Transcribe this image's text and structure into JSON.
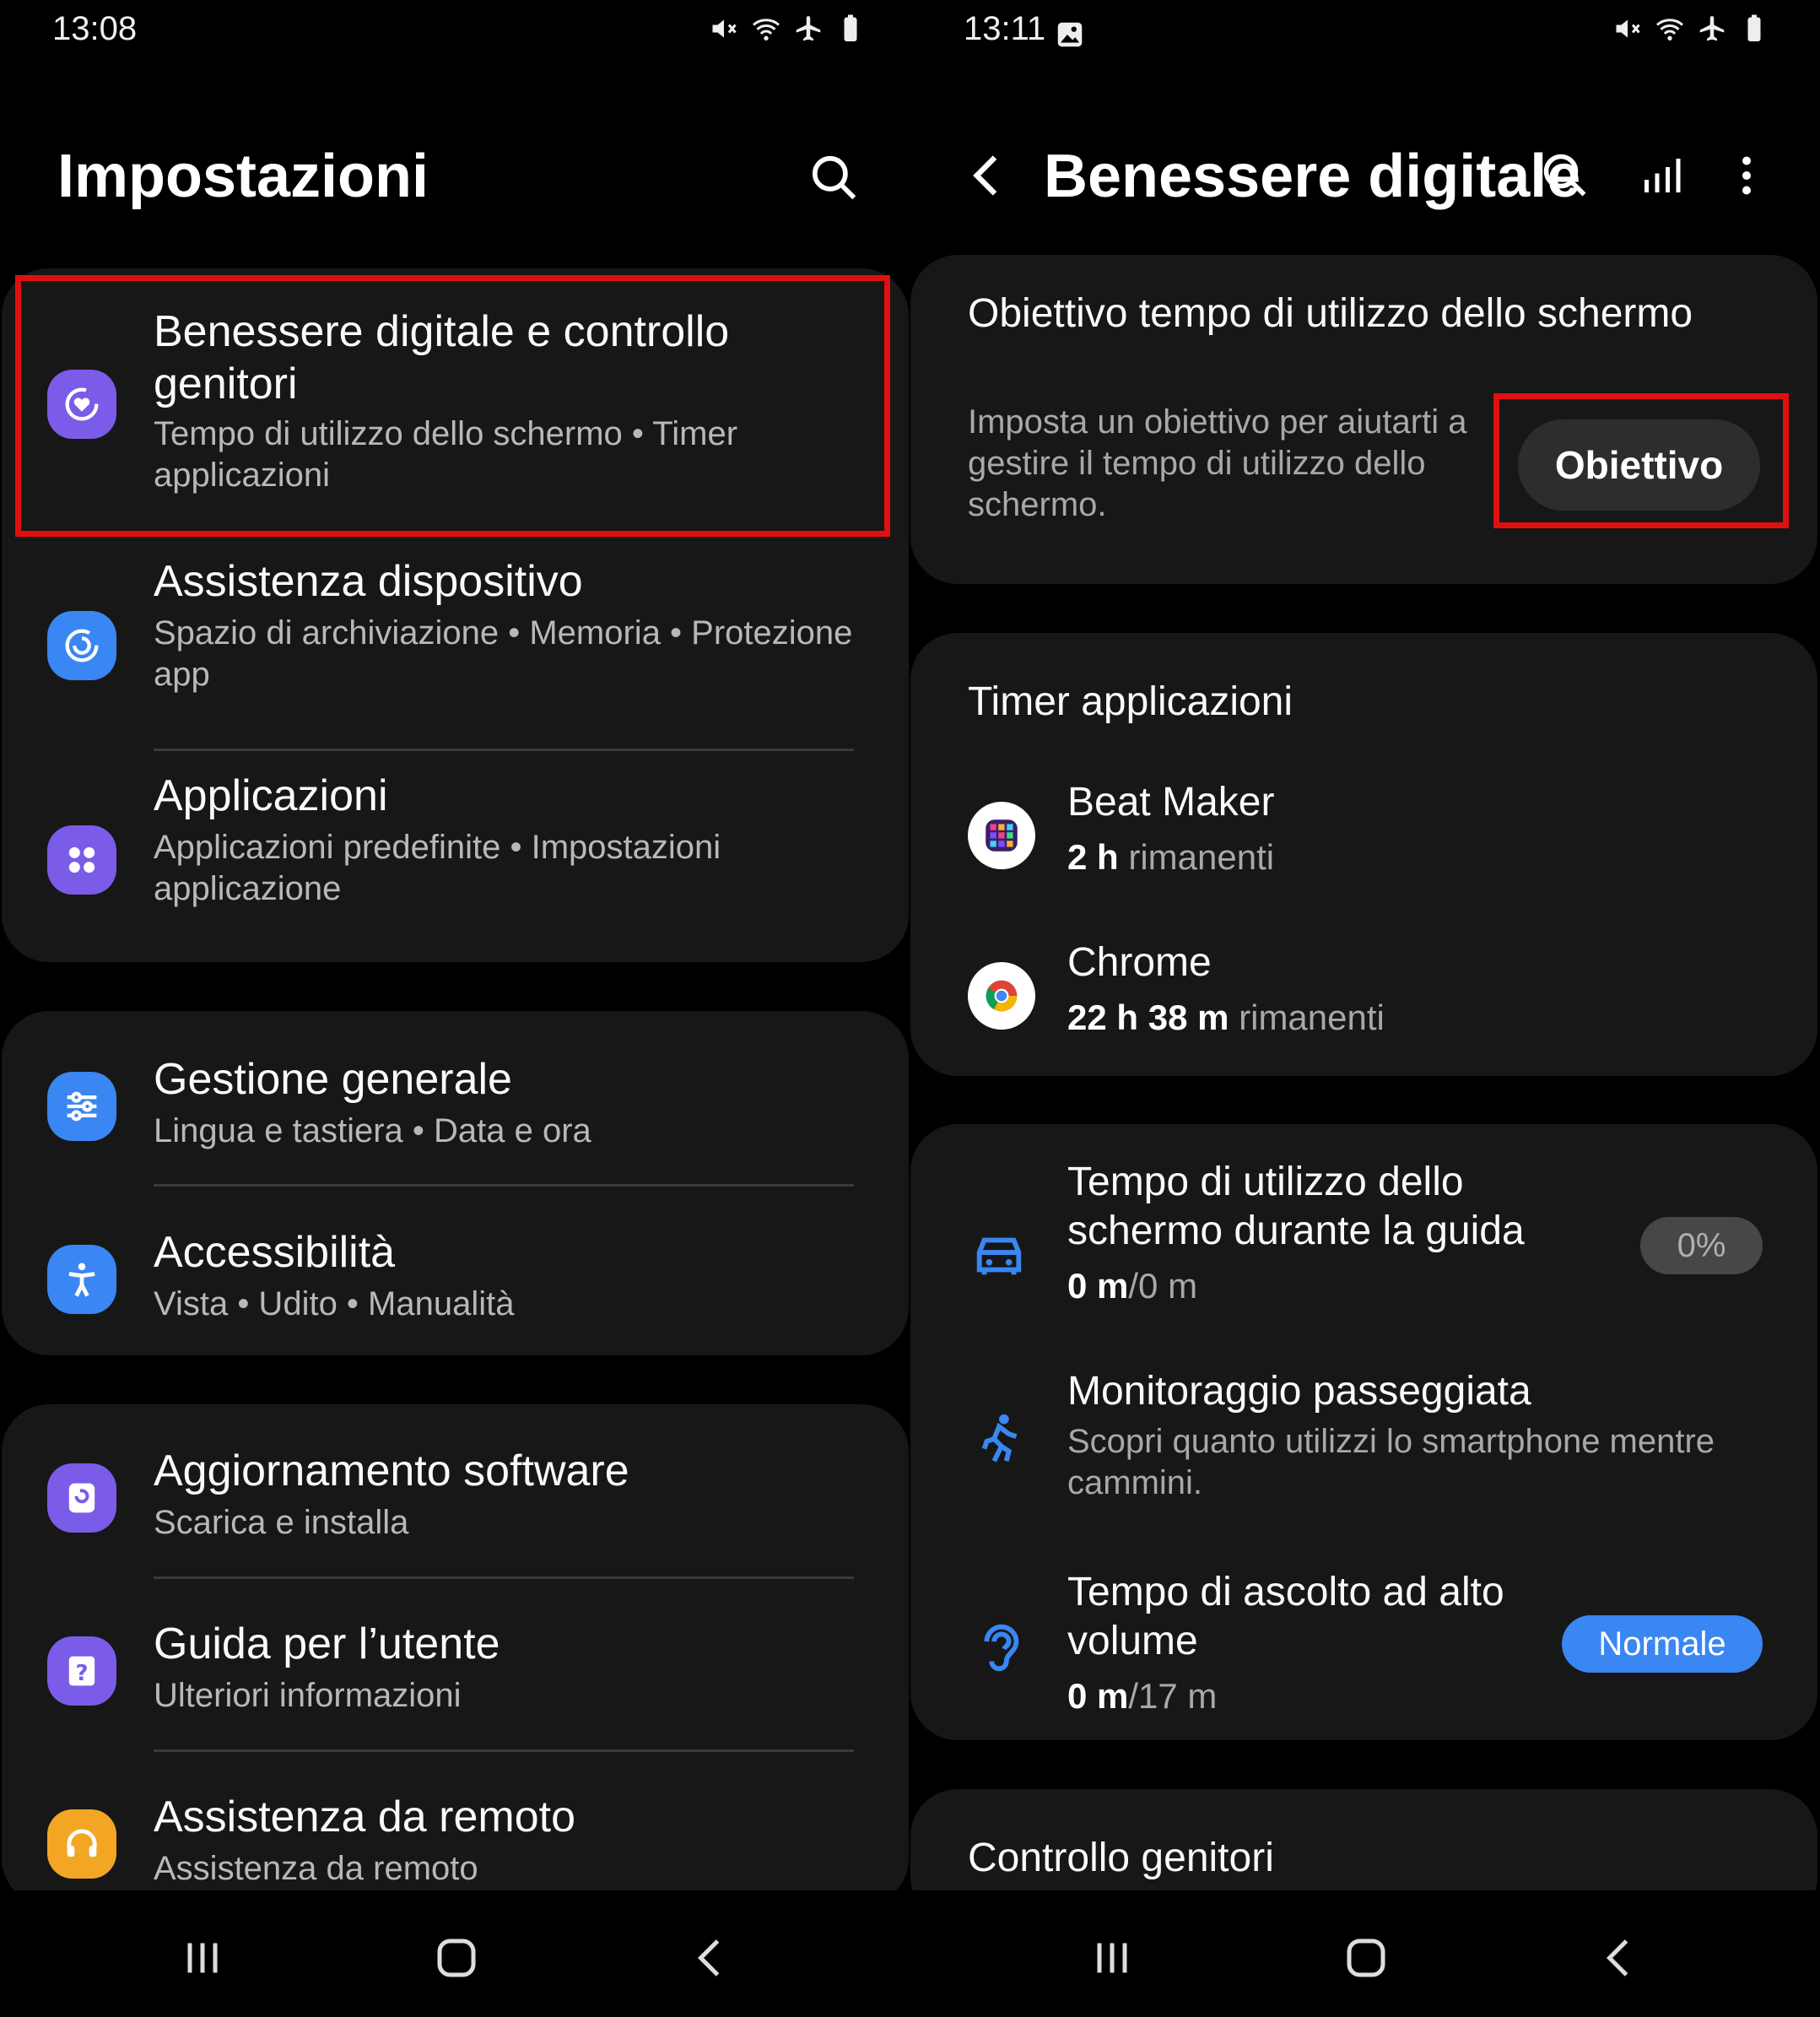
{
  "left": {
    "status_time": "13:08",
    "title": "Impostazioni",
    "groups": [
      [
        {
          "title": "Benessere digitale e controllo genitori",
          "subtitle": "Tempo di utilizzo dello schermo  •  Timer applicazioni",
          "icon": "heart-circle-icon",
          "color": "#7a5ce8"
        },
        {
          "title": "Assistenza dispositivo",
          "subtitle": "Spazio di archiviazione  •  Memoria  •  Protezione app",
          "icon": "device-care-icon",
          "color": "#3a86f2"
        },
        {
          "title": "Applicazioni",
          "subtitle": "Applicazioni predefinite  •  Impostazioni applicazione",
          "icon": "apps-grid-icon",
          "color": "#7a5ce8"
        }
      ],
      [
        {
          "title": "Gestione generale",
          "subtitle": "Lingua e tastiera  •  Data e ora",
          "icon": "sliders-icon",
          "color": "#3a86f2"
        },
        {
          "title": "Accessibilità",
          "subtitle": "Vista  •  Udito  •  Manualità",
          "icon": "accessibility-icon",
          "color": "#3a86f2"
        }
      ],
      [
        {
          "title": "Aggiornamento software",
          "subtitle": "Scarica e installa",
          "icon": "software-update-icon",
          "color": "#7a5ce8"
        },
        {
          "title": "Guida per l’utente",
          "subtitle": "Ulteriori informazioni",
          "icon": "user-guide-icon",
          "color": "#7a5ce8"
        },
        {
          "title": "Assistenza da remoto",
          "subtitle": "Assistenza da remoto",
          "icon": "headset-icon",
          "color": "#f3a623"
        }
      ]
    ]
  },
  "right": {
    "status_time": "13:11",
    "title": "Benessere digitale",
    "goal": {
      "heading": "Obiettivo tempo di utilizzo dello schermo",
      "description": "Imposta un obiettivo per aiutarti a gestire il tempo di utilizzo dello schermo.",
      "button": "Obiettivo"
    },
    "timers": {
      "heading": "Timer applicazioni",
      "apps": [
        {
          "name": "Beat Maker",
          "value": "2 h",
          "suffix": " rimanenti",
          "icon": "beat-maker-icon"
        },
        {
          "name": "Chrome",
          "value": "22 h 38 m",
          "suffix": " rimanenti",
          "icon": "chrome-icon"
        }
      ]
    },
    "driving": {
      "title": "Tempo di utilizzo dello schermo durante la guida",
      "value": "0 m",
      "total": "/0 m",
      "badge": "0%"
    },
    "walking": {
      "title": "Monitoraggio passeggiata",
      "subtitle": "Scopri quanto utilizzi lo smartphone mentre cammini."
    },
    "volume": {
      "title": "Tempo di ascolto ad alto volume",
      "value": "0 m",
      "total": "/17 m",
      "badge": "Normale"
    },
    "parental": {
      "heading": "Controllo genitori"
    }
  },
  "colors": {
    "highlight": "#e01010",
    "accent": "#3a86f2",
    "card": "#171717"
  }
}
